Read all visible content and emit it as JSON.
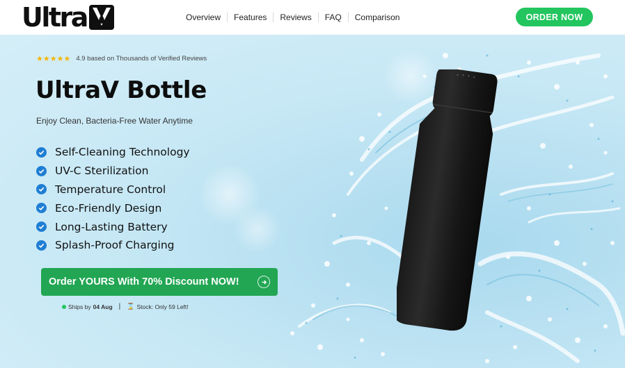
{
  "header": {
    "logo_text": "Ultra",
    "nav": [
      "Overview",
      "Features",
      "Reviews",
      "FAQ",
      "Comparison"
    ],
    "order_button": "ORDER NOW"
  },
  "hero": {
    "stars": "★★★★★",
    "rating_text": "4.9 based on Thousands of Verified Reviews",
    "title": "UltraV Bottle",
    "subtitle": "Enjoy Clean, Bacteria-Free Water Anytime",
    "features": [
      "Self-Cleaning Technology",
      "UV-C Sterilization",
      "Temperature Control",
      "Eco-Friendly Design",
      "Long-Lasting Battery",
      "Splash-Proof Charging"
    ],
    "cta_label": "Order YOURS With 70% Discount NOW!",
    "ships_prefix": "Ships by",
    "ships_date": "04 Aug",
    "stock_text": "Stock: Only 59 Left!"
  },
  "colors": {
    "accent_green": "#22c55e",
    "cta_green": "#22a653",
    "check_blue": "#1f7ed3",
    "star_gold": "#f5b50a",
    "hero_bg": "#c7e8f5"
  },
  "icons": [
    "logo-v-icon",
    "star-icon",
    "check-icon",
    "arrow-right-icon",
    "hourglass-icon"
  ]
}
